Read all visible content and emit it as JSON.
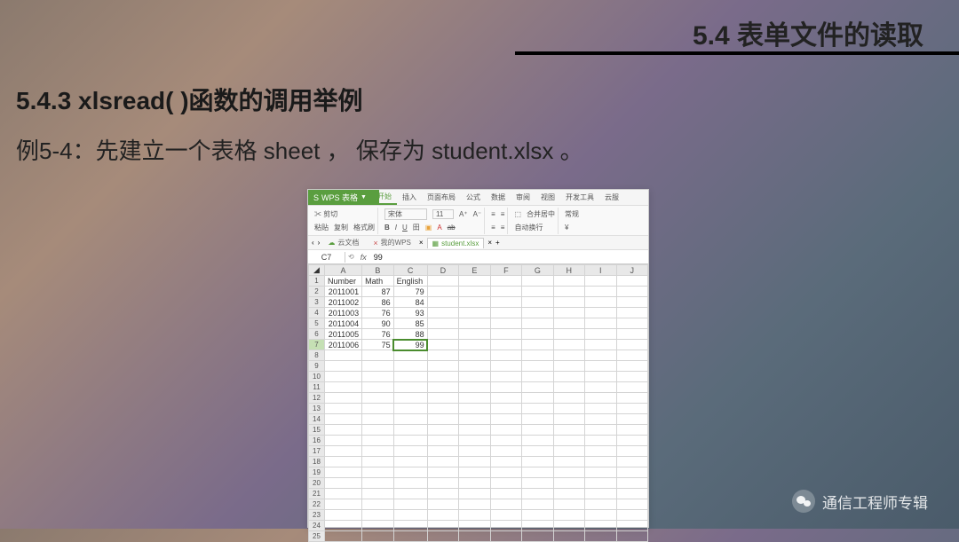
{
  "header": {
    "chapter_title": "5.4  表单文件的读取"
  },
  "section": {
    "title": "5.4.3  xlsread( )函数的调用举例",
    "example_text": "例5-4：先建立一个表格 sheet ， 保存为 student.xlsx 。"
  },
  "spreadsheet": {
    "app_name": "WPS 表格",
    "menu": {
      "active": "开始",
      "items": [
        "开始",
        "插入",
        "页面布局",
        "公式",
        "数据",
        "审阅",
        "视图",
        "开发工具",
        "云服"
      ]
    },
    "toolbar": {
      "cut": "剪切",
      "paste": "粘贴",
      "copy": "复制",
      "format_painter": "格式刷",
      "font_name": "宋体",
      "font_size": "11",
      "merge": "合并居中",
      "wrap": "自动换行",
      "general": "常规"
    },
    "doc_tabs": {
      "cloud": "云文档",
      "my_wps": "我的WPS",
      "active_file": "student.xlsx"
    },
    "formula_bar": {
      "cell_ref": "C7",
      "fx": "fx",
      "value": "99"
    },
    "columns": [
      "A",
      "B",
      "C",
      "D",
      "E",
      "F",
      "G",
      "H",
      "I",
      "J"
    ],
    "selected_row": 7,
    "selected_cell": "C7",
    "data_rows": 25,
    "chart_data": {
      "type": "table",
      "headers": [
        "Number",
        "Math",
        "English"
      ],
      "rows": [
        [
          "2011001",
          87,
          79
        ],
        [
          "2011002",
          86,
          84
        ],
        [
          "2011003",
          76,
          93
        ],
        [
          "2011004",
          90,
          85
        ],
        [
          "2011005",
          76,
          88
        ],
        [
          "2011006",
          75,
          99
        ]
      ]
    }
  },
  "watermark": {
    "text": "通信工程师专辑"
  }
}
